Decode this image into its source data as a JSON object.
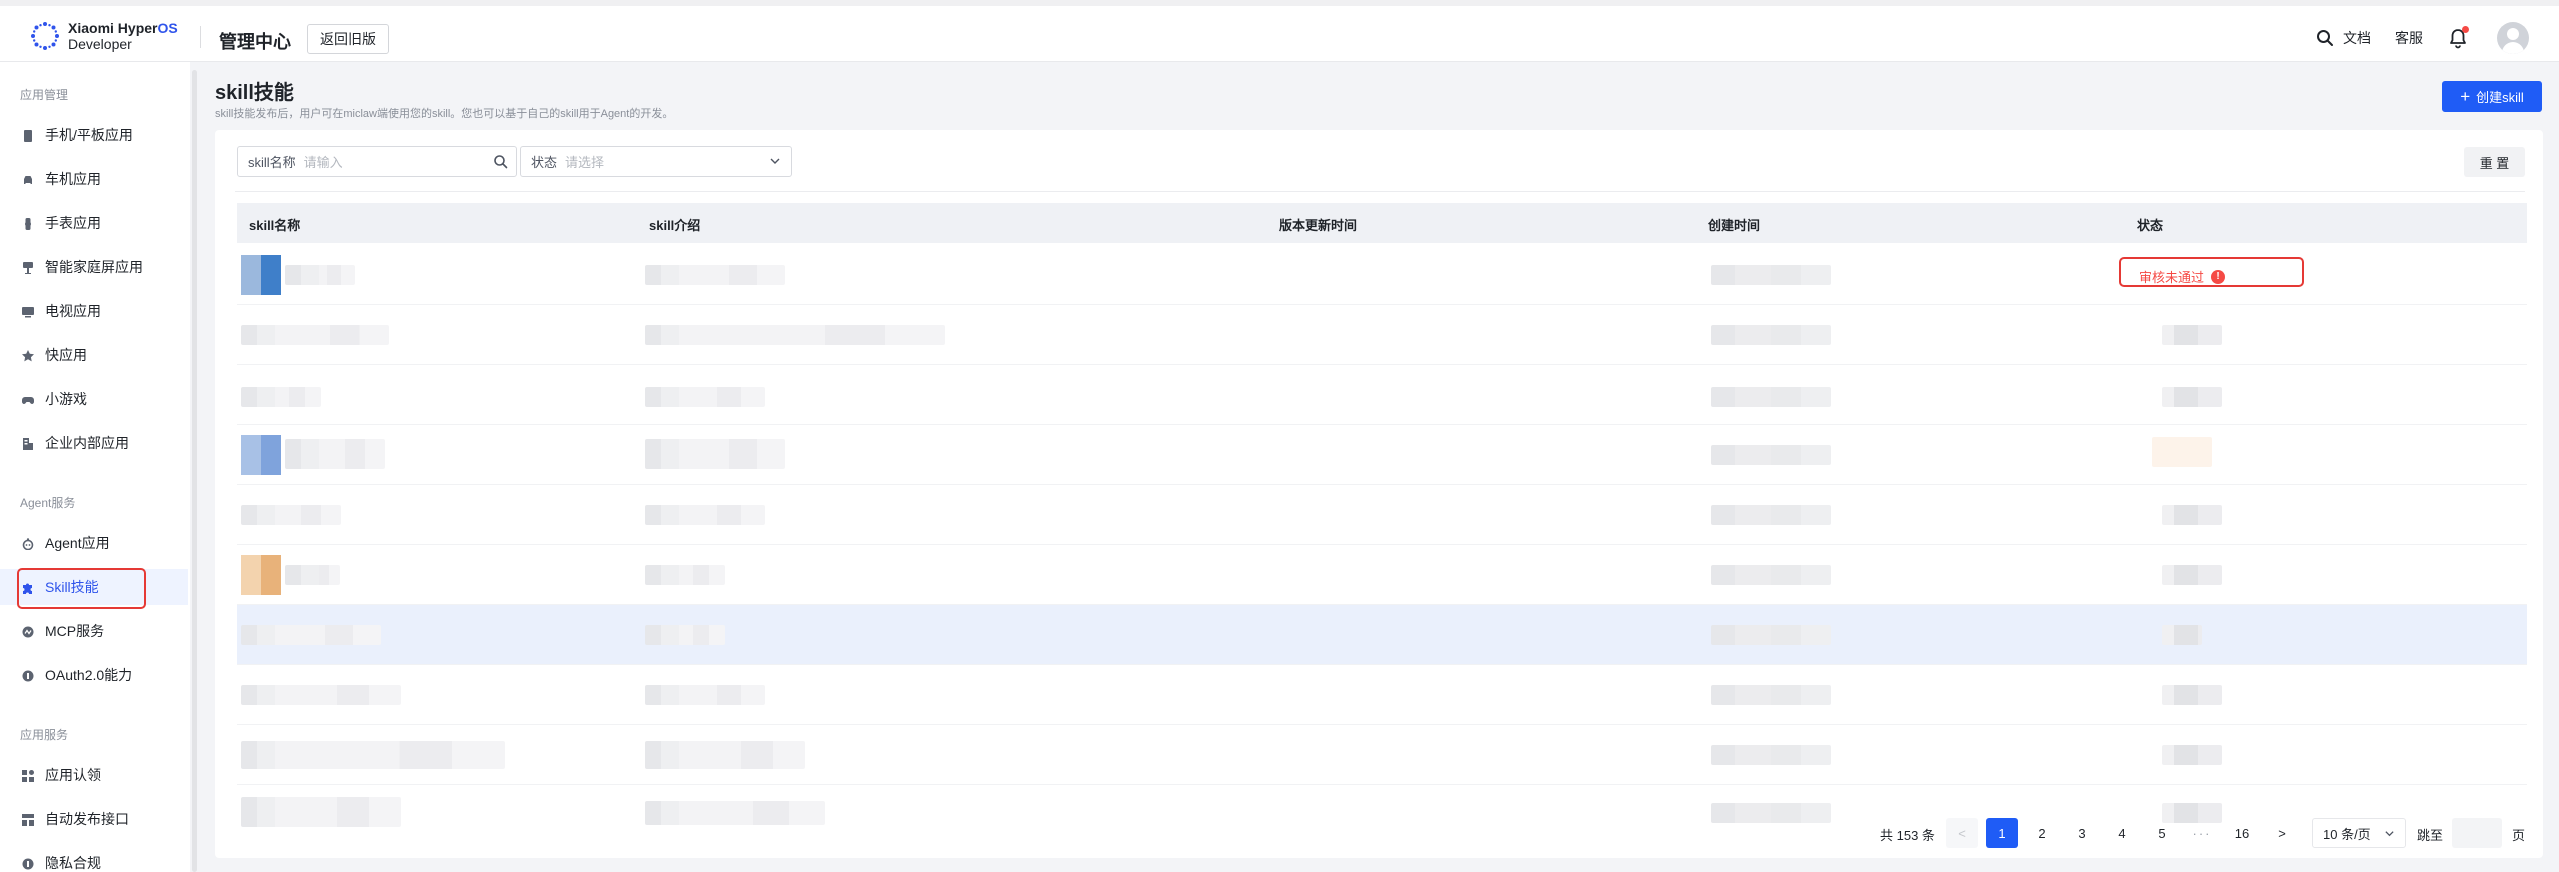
{
  "header": {
    "logo_line1": "Xiaomi Hyper",
    "logo_line1_os": "OS",
    "logo_line2": "Developer",
    "title": "管理中心",
    "back_button": "返回旧版",
    "search_icon": "search-icon",
    "docs_label": "文档",
    "support_label": "客服",
    "bell_icon": "bell-icon",
    "avatar_icon": "user-avatar-icon"
  },
  "sidebar": {
    "groups": [
      {
        "title": "应用管理"
      },
      {
        "title": "Agent服务"
      },
      {
        "title": "应用服务"
      }
    ],
    "items": [
      {
        "label": "手机/平板应用",
        "icon": "phone-icon"
      },
      {
        "label": "车机应用",
        "icon": "car-icon"
      },
      {
        "label": "手表应用",
        "icon": "watch-icon"
      },
      {
        "label": "智能家庭屏应用",
        "icon": "home-screen-icon"
      },
      {
        "label": "电视应用",
        "icon": "tv-icon"
      },
      {
        "label": "快应用",
        "icon": "star-icon"
      },
      {
        "label": "小游戏",
        "icon": "gamepad-icon"
      },
      {
        "label": "企业内部应用",
        "icon": "building-icon"
      },
      {
        "label": "Agent应用",
        "icon": "robot-icon"
      },
      {
        "label": "Skill技能",
        "icon": "puzzle-icon",
        "active": true
      },
      {
        "label": "MCP服务",
        "icon": "mcp-icon"
      },
      {
        "label": "OAuth2.0能力",
        "icon": "shield-icon"
      },
      {
        "label": "应用认领",
        "icon": "claim-icon"
      },
      {
        "label": "自动发布接口",
        "icon": "publish-icon"
      },
      {
        "label": "隐私合规",
        "icon": "privacy-icon"
      }
    ]
  },
  "main": {
    "title": "skill技能",
    "description": "skill技能发布后，用户可在miclaw端使用您的skill。您也可以基于自己的skill用于Agent的开发。",
    "create_button": "创建skill",
    "filters": {
      "name_label": "skill名称",
      "name_placeholder": "请输入",
      "status_label": "状态",
      "status_placeholder": "请选择"
    },
    "reset_button": "重 置",
    "table": {
      "columns": [
        "skill名称",
        "skill介绍",
        "版本更新时间",
        "创建时间",
        "状态"
      ],
      "first_row_status": "审核未通过",
      "status_alert_icon": "exclamation-icon"
    },
    "pagination": {
      "total": "共 153 条",
      "prev": "<",
      "pages": [
        "1",
        "2",
        "3",
        "4",
        "5"
      ],
      "ellipsis": "···",
      "last": "16",
      "next": ">",
      "page_size": "10 条/页",
      "jump_label": "跳至",
      "page_suffix": "页"
    }
  }
}
